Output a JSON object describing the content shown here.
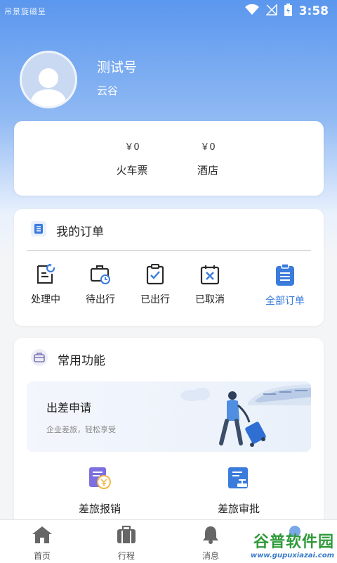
{
  "status_bar": {
    "time": "3:58",
    "left_text": "吊景旋磁呈"
  },
  "profile": {
    "name": "测试号",
    "company": "云谷"
  },
  "balances": [
    {
      "amount": "￥0",
      "label": "火车票"
    },
    {
      "amount": "￥0",
      "label": "酒店"
    }
  ],
  "orders": {
    "title": "我的订单",
    "items": [
      {
        "label": "处理中",
        "icon": "processing-doc-icon"
      },
      {
        "label": "待出行",
        "icon": "suitcase-clock-icon"
      },
      {
        "label": "已出行",
        "icon": "clipboard-check-icon"
      },
      {
        "label": "已取消",
        "icon": "cancel-box-icon"
      },
      {
        "label": "全部订单",
        "icon": "all-orders-icon"
      }
    ]
  },
  "features": {
    "title": "常用功能",
    "banner": {
      "title": "出差申请",
      "subtitle": "企业差旅，轻松享受"
    },
    "items": [
      {
        "label": "差旅报销",
        "icon": "reimburse-icon"
      },
      {
        "label": "差旅审批",
        "icon": "approval-icon"
      }
    ]
  },
  "tabbar": [
    {
      "label": "首页",
      "icon": "home-icon"
    },
    {
      "label": "行程",
      "icon": "suitcase-icon"
    },
    {
      "label": "消息",
      "icon": "bell-icon"
    }
  ],
  "watermark": {
    "main": "谷普软件园",
    "url": "www.gupuxiazai.com"
  },
  "colors": {
    "accent": "#3a7bdc",
    "hero_top": "#5b97ee",
    "icon_dark": "#2b2b2b"
  }
}
